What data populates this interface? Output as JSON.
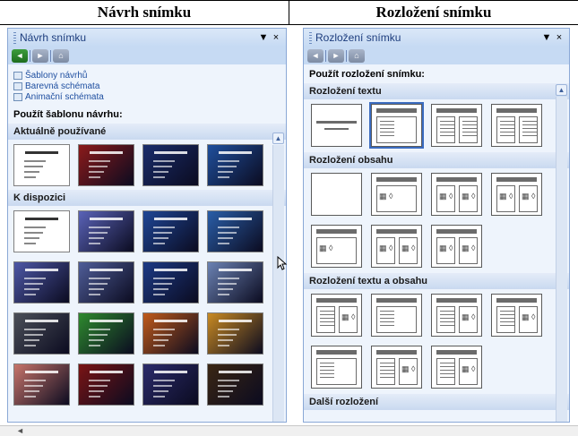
{
  "headers": {
    "left": "Návrh snímku",
    "right": "Rozložení snímku"
  },
  "left_pane": {
    "title": "Návrh snímku",
    "links": [
      {
        "label": "Šablony návrhů",
        "icon": "templates-icon"
      },
      {
        "label": "Barevná schémata",
        "icon": "color-schemes-icon"
      },
      {
        "label": "Animační schémata",
        "icon": "animation-schemes-icon"
      }
    ],
    "apply_label": "Použít šablonu návrhu:",
    "group_current": "Aktuálně používané",
    "group_available": "K dispozici",
    "thumb_colors_current": [
      "#ffffff",
      "#8b1a1a",
      "#1a2d6b",
      "#1f4f9c"
    ],
    "thumb_colors_available": [
      "#ffffff",
      "#5a63b8",
      "#1e4696",
      "#2a5ea8",
      "#4d57a6",
      "#4f5d98",
      "#1c3a85",
      "#6b82b3",
      "#4b4f58",
      "#2e8a2e",
      "#c05a1a",
      "#c98a22",
      "#c7746a",
      "#7a1414",
      "#2b2b6b",
      "#3a2613"
    ]
  },
  "right_pane": {
    "title": "Rozložení snímku",
    "apply_label": "Použít rozložení snímku:",
    "groups": [
      {
        "name": "Rozložení textu",
        "count": 4
      },
      {
        "name": "Rozložení obsahu",
        "count": 7
      },
      {
        "name": "Rozložení textu a obsahu",
        "count": 7
      },
      {
        "name": "Další rozložení",
        "count": 0
      }
    ]
  },
  "controls": {
    "dropdown": "▼",
    "close": "×",
    "scroll_up": "▲",
    "scroll_left": "◄"
  }
}
